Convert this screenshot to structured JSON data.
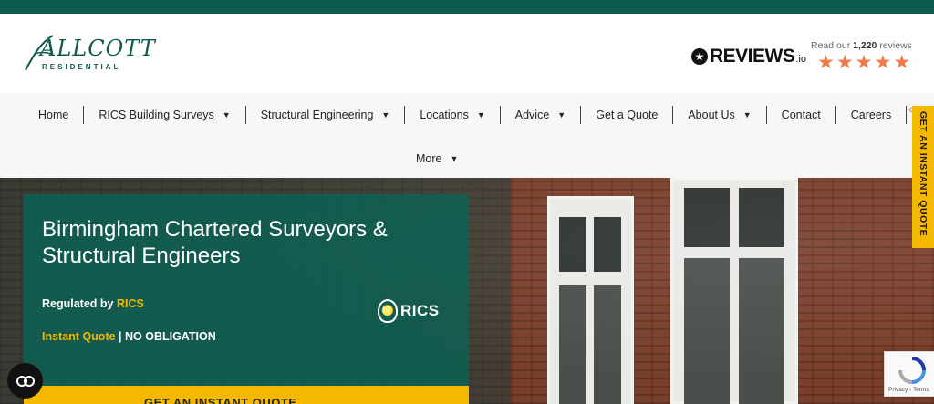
{
  "brand": {
    "logo_main": "ALLCOTT",
    "logo_sub": "RESIDENTIAL",
    "color_primary": "#0e5a4f",
    "color_accent": "#f5b800"
  },
  "reviews": {
    "brand_text": "REVIEWS",
    "brand_suffix": ".io",
    "count_prefix": "Read our ",
    "count_value": "1,220",
    "count_suffix": " reviews",
    "rating": 4.5,
    "star_color": "#f07a4a"
  },
  "nav": {
    "items": [
      {
        "label": "Home",
        "dropdown": false
      },
      {
        "label": "RICS Building Surveys",
        "dropdown": true
      },
      {
        "label": "Structural Engineering",
        "dropdown": true
      },
      {
        "label": "Locations",
        "dropdown": true
      },
      {
        "label": "Advice",
        "dropdown": true
      },
      {
        "label": "Get a Quote",
        "dropdown": false
      },
      {
        "label": "About Us",
        "dropdown": true
      },
      {
        "label": "Contact",
        "dropdown": false
      },
      {
        "label": "Careers",
        "dropdown": false
      }
    ],
    "more_label": "More"
  },
  "hero": {
    "title": "Birmingham Chartered Surveyors & Structural Engineers",
    "regulated_prefix": "Regulated by ",
    "regulated_accent": "RICS",
    "quote_accent": "Instant Quote",
    "quote_suffix": " | NO OBLIGATION",
    "rics_logo_text": "RICS",
    "cta_label": "GET AN INSTANT QUOTE"
  },
  "side_tab": {
    "label": "GET AN INSTANT QUOTE"
  },
  "chat": {
    "icon": "chat-bubble-icon"
  },
  "recaptcha": {
    "terms": "Privacy - Terms"
  }
}
